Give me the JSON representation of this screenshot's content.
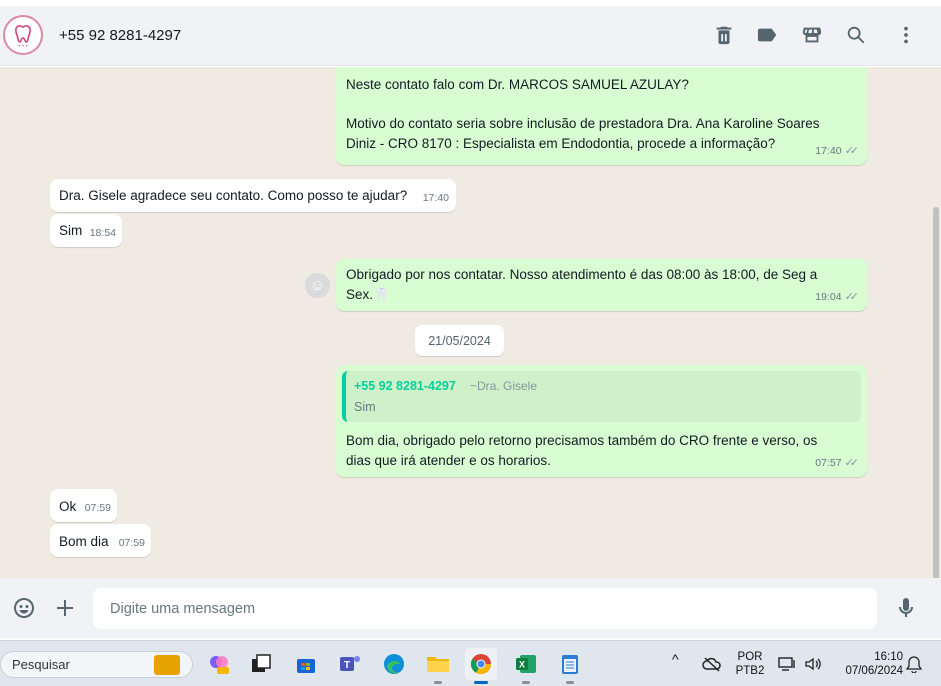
{
  "header": {
    "contact_name": "+55 92 8281-4297",
    "icons": [
      "delete-icon",
      "label-icon",
      "catalog-icon",
      "search-icon",
      "menu-icon"
    ]
  },
  "messages": [
    {
      "direction": "out",
      "lines": [
        "Neste contato falo com Dr. MARCOS SAMUEL AZULAY?",
        "",
        "Motivo do contato seria sobre inclusão de prestadora Dra. Ana Karoline Soares",
        "Diniz - CRO 8170  : Especialista em Endodontia, procede a informação?"
      ],
      "time": "17:40"
    },
    {
      "direction": "in",
      "text": "Dra. Gisele agradece seu contato. Como posso te ajudar?",
      "time": "17:40"
    },
    {
      "direction": "in",
      "text": "Sim",
      "time": "18:54"
    },
    {
      "direction": "out",
      "lines": [
        "Obrigado por nos contatar. Nosso atendimento é das 08:00 às 18:00, de Seg a",
        "Sex.🦷"
      ],
      "time": "19:04"
    },
    {
      "direction": "out",
      "quote": {
        "author": "+55 92 8281-4297",
        "pushname": "~Dra. Gisele",
        "text": "Sim"
      },
      "lines": [
        "Bom dia, obrigado pelo retorno precisamos também do CRO frente e verso, os",
        "dias que irá atender e os horarios."
      ],
      "time": "07:57"
    },
    {
      "direction": "in",
      "text": "Ok",
      "time": "07:59"
    },
    {
      "direction": "in",
      "text": "Bom dia",
      "time": "07:59"
    }
  ],
  "date_divider": "21/05/2024",
  "composer": {
    "placeholder": "Digite uma mensagem"
  },
  "taskbar": {
    "search_label": "Pesquisar",
    "language_top": "POR",
    "language_bottom": "PTB2",
    "clock_time": "16:10",
    "clock_date": "07/06/2024"
  },
  "colors": {
    "outgoing_bubble": "#d9fdd3",
    "incoming_bubble": "#ffffff",
    "chat_background": "#efeae2",
    "accent_green": "#06cf9c"
  }
}
